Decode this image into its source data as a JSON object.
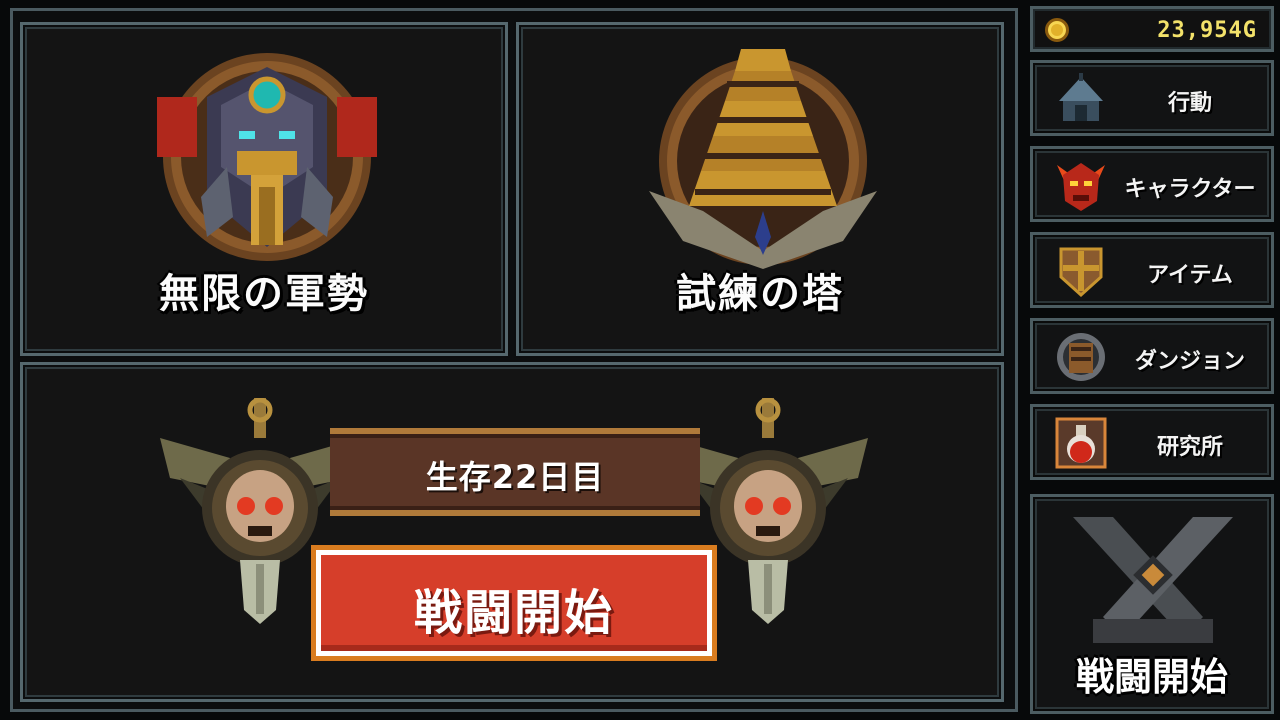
{
  "gold": {
    "value": "23,954G",
    "icon": "gold-coin-icon"
  },
  "modes": {
    "infinite_army": {
      "label": "無限の軍勢",
      "icon": "golem-emblem-icon"
    },
    "trial_tower": {
      "label": "試練の塔",
      "icon": "tower-emblem-icon"
    }
  },
  "battle": {
    "days_label": "生存22日目",
    "start_label": "戦闘開始",
    "decoration_icon": "skull-shield-icon"
  },
  "menu": [
    {
      "label": "行動",
      "icon": "tent-icon"
    },
    {
      "label": "キャラクター",
      "icon": "demon-mask-icon"
    },
    {
      "label": "アイテム",
      "icon": "shield-icon"
    },
    {
      "label": "ダンジョン",
      "icon": "dungeon-gate-icon"
    },
    {
      "label": "研究所",
      "icon": "potion-icon"
    }
  ],
  "sidebar_battle": {
    "label": "戦闘開始",
    "icon": "crossed-swords-icon"
  },
  "colors": {
    "accent_red": "#d63e2a",
    "frame": "#55686e",
    "gold_text": "#f3e26a"
  }
}
